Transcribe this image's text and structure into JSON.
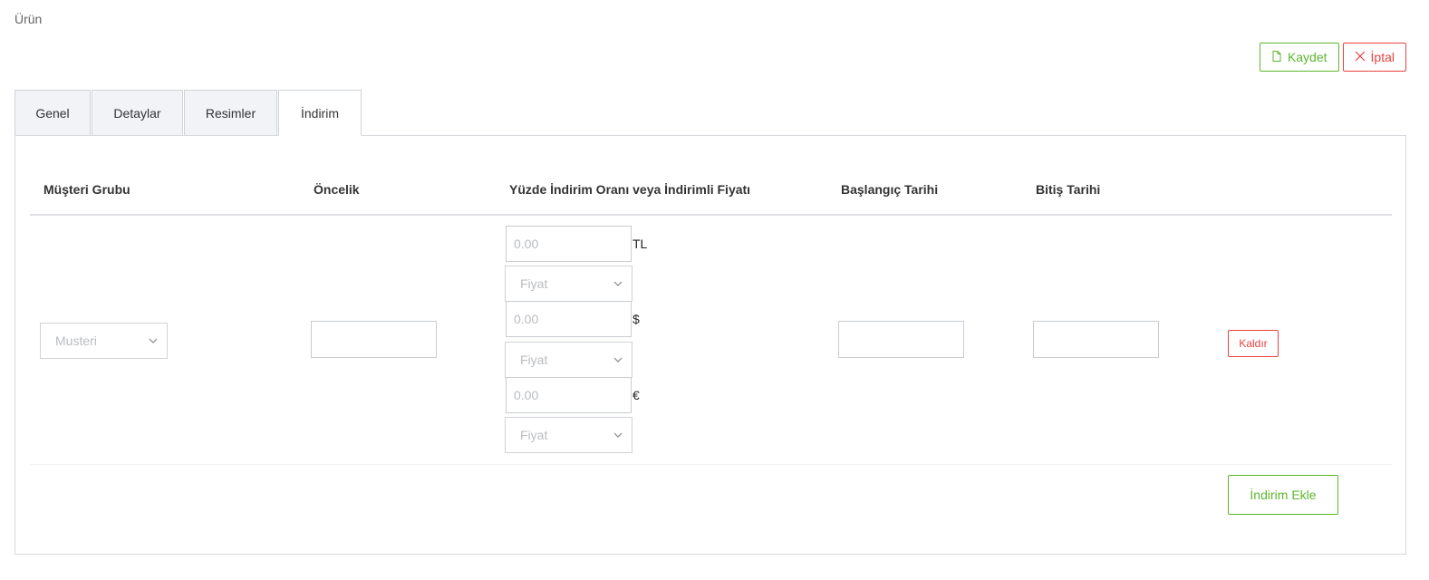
{
  "page": {
    "title": "Ürün"
  },
  "toolbar": {
    "save_label": "Kaydet",
    "cancel_label": "İptal"
  },
  "tabs": [
    {
      "label": "Genel"
    },
    {
      "label": "Detaylar"
    },
    {
      "label": "Resimler"
    },
    {
      "label": "İndirim",
      "active": true
    }
  ],
  "table": {
    "headers": {
      "customer_group": "Müşteri Grubu",
      "priority": "Öncelik",
      "discount": "Yüzde İndirim Oranı veya İndirimli Fiyatı",
      "start_date": "Başlangıç Tarihi",
      "end_date": "Bitiş Tarihi"
    },
    "row": {
      "customer_group": "Musteri",
      "priority": "",
      "start_date": "",
      "end_date": "",
      "prices": [
        {
          "placeholder": "0.00",
          "currency": "TL",
          "type": "Fiyat"
        },
        {
          "placeholder": "0.00",
          "currency": "$",
          "type": "Fiyat"
        },
        {
          "placeholder": "0.00",
          "currency": "€",
          "type": "Fiyat"
        }
      ],
      "remove_label": "Kaldır"
    },
    "add_label": "İndirim Ekle"
  },
  "colors": {
    "success": "#5cb62c",
    "danger": "#e9413f",
    "border": "#cfd3da"
  },
  "icons": {
    "save": "file-icon",
    "cancel": "close-icon",
    "select": "chevron-down-icon"
  }
}
